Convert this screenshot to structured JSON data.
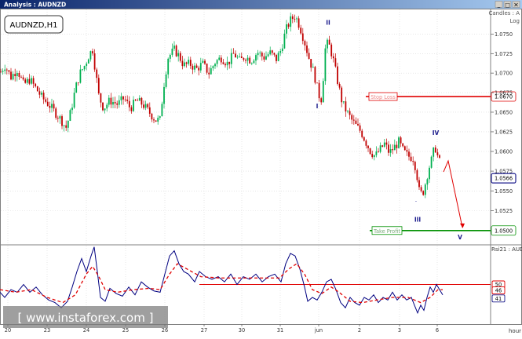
{
  "window": {
    "title": "Analysis : AUDNZD",
    "minimize_glyph": "_",
    "maximize_glyph": "□",
    "close_glyph": "×",
    "titlebar_color": "#0a246a",
    "titlebar_color_end": "#a6caf0"
  },
  "price_panel": {
    "symbol_label": "AUDNZD,H1",
    "chart_type_label": "Candles : A",
    "scale_label": "Log"
  },
  "indicator_panel": {
    "label": "Rsi21 : AUD",
    "levels_shown": [
      50,
      46,
      41
    ]
  },
  "watermark": "[ www.instaforex.com ]",
  "x_axis_unit": "hour",
  "colors": {
    "bull_candle": "#00b050",
    "bear_candle": "#c00000",
    "stop_loss": "#e00000",
    "take_profit": "#009000",
    "current_price": "#1a1a8c",
    "rsi": "#000080",
    "rsi_ma": "#e00000",
    "wave_label": "#1a1a8c",
    "grid": "#d8d8d8",
    "axis_text": "#333333"
  },
  "chart_data": [
    {
      "type": "candlestick",
      "title": "AUDNZD,H1",
      "x_ticks": [
        "20",
        "23",
        "24",
        "25",
        "26",
        "27",
        "30",
        "31",
        "jun",
        "2",
        "3",
        "6"
      ],
      "x_unit": "hour",
      "y_ticks": [
        "1.0750",
        "1.0725",
        "1.0700",
        "1.0675",
        "1.0650",
        "1.0625",
        "1.0600",
        "1.0575",
        "1.0550",
        "1.0525"
      ],
      "ylim": [
        1.0483,
        1.0782
      ],
      "log_scale": true,
      "grid": true,
      "price_path": [
        [
          0,
          1.07
        ],
        [
          6,
          1.071
        ],
        [
          14,
          1.0695
        ],
        [
          22,
          1.0705
        ],
        [
          30,
          1.0685
        ],
        [
          38,
          1.0692
        ],
        [
          46,
          1.068
        ],
        [
          54,
          1.0668
        ],
        [
          62,
          1.066
        ],
        [
          70,
          1.065
        ],
        [
          78,
          1.064
        ],
        [
          84,
          1.063
        ],
        [
          90,
          1.065
        ],
        [
          96,
          1.068
        ],
        [
          102,
          1.07
        ],
        [
          108,
          1.071
        ],
        [
          114,
          1.0725
        ],
        [
          118,
          1.073
        ],
        [
          122,
          1.07
        ],
        [
          126,
          1.067
        ],
        [
          132,
          1.0655
        ],
        [
          140,
          1.0665
        ],
        [
          150,
          1.066
        ],
        [
          158,
          1.0668
        ],
        [
          166,
          1.0655
        ],
        [
          174,
          1.0665
        ],
        [
          182,
          1.066
        ],
        [
          190,
          1.065
        ],
        [
          198,
          1.064
        ],
        [
          204,
          1.064
        ],
        [
          208,
          1.068
        ],
        [
          214,
          1.072
        ],
        [
          222,
          1.073
        ],
        [
          228,
          1.0722
        ],
        [
          234,
          1.071
        ],
        [
          242,
          1.0712
        ],
        [
          250,
          1.0705
        ],
        [
          258,
          1.0712
        ],
        [
          266,
          1.07
        ],
        [
          274,
          1.0714
        ],
        [
          282,
          1.072
        ],
        [
          290,
          1.0712
        ],
        [
          298,
          1.0725
        ],
        [
          306,
          1.0715
        ],
        [
          312,
          1.0722
        ],
        [
          320,
          1.0716
        ],
        [
          328,
          1.0727
        ],
        [
          336,
          1.072
        ],
        [
          344,
          1.0726
        ],
        [
          352,
          1.0718
        ],
        [
          358,
          1.073
        ],
        [
          364,
          1.0755
        ],
        [
          370,
          1.0768
        ],
        [
          376,
          1.0774
        ],
        [
          382,
          1.076
        ],
        [
          388,
          1.074
        ],
        [
          394,
          1.0718
        ],
        [
          400,
          1.07
        ],
        [
          406,
          1.0672
        ],
        [
          410,
          1.0666
        ],
        [
          414,
          1.073
        ],
        [
          418,
          1.074
        ],
        [
          424,
          1.072
        ],
        [
          430,
          1.069
        ],
        [
          436,
          1.0662
        ],
        [
          442,
          1.065
        ],
        [
          448,
          1.064
        ],
        [
          454,
          1.0632
        ],
        [
          460,
          1.0625
        ],
        [
          466,
          1.0612
        ],
        [
          472,
          1.06
        ],
        [
          478,
          1.0594
        ],
        [
          484,
          1.0602
        ],
        [
          490,
          1.061
        ],
        [
          496,
          1.0598
        ],
        [
          502,
          1.0605
        ],
        [
          508,
          1.0612
        ],
        [
          514,
          1.06
        ],
        [
          520,
          1.0594
        ],
        [
          526,
          1.0592
        ],
        [
          530,
          1.0578
        ],
        [
          534,
          1.055
        ],
        [
          538,
          1.0545
        ],
        [
          542,
          1.056
        ],
        [
          546,
          1.0578
        ],
        [
          550,
          1.059
        ],
        [
          554,
          1.0607
        ],
        [
          558,
          1.0592
        ],
        [
          562,
          1.0582
        ]
      ],
      "horizontal_levels": [
        {
          "name": "Stop Loss",
          "value": 1.067
        },
        {
          "name": "Take Profit",
          "value": 1.05
        }
      ],
      "current_price": 1.0566,
      "wave_labels": [
        {
          "text": "I",
          "x": 404,
          "price": 1.0655
        },
        {
          "text": "II",
          "x": 418,
          "price": 1.0762
        },
        {
          "text": "III",
          "x": 532,
          "price": 1.0511
        },
        {
          "text": "IV",
          "x": 555,
          "price": 1.0621
        },
        {
          "text": "V",
          "x": 586,
          "price": 1.0489
        }
      ],
      "wave_labels_small": [
        {
          "text": "-",
          "x": 530,
          "price": 1.0535
        }
      ],
      "projection": [
        [
          565,
          1.0574
        ],
        [
          571,
          1.0588
        ],
        [
          589,
          1.0504
        ]
      ]
    },
    {
      "type": "line",
      "title": "Rsi21 : AUD",
      "x_ticks": [
        "20",
        "23",
        "24",
        "25",
        "26",
        "27",
        "30",
        "31",
        "jun",
        "2",
        "3",
        "6"
      ],
      "x_unit": "hour",
      "levels": [
        50,
        46,
        41
      ],
      "ylim": [
        20,
        80
      ],
      "series": [
        {
          "values": [
            [
              0,
              44
            ],
            [
              6,
              40
            ],
            [
              14,
              46
            ],
            [
              22,
              44
            ],
            [
              30,
              50
            ],
            [
              38,
              44
            ],
            [
              46,
              48
            ],
            [
              54,
              42
            ],
            [
              62,
              38
            ],
            [
              70,
              36
            ],
            [
              78,
              32
            ],
            [
              86,
              37
            ],
            [
              92,
              48
            ],
            [
              98,
              60
            ],
            [
              104,
              70
            ],
            [
              110,
              60
            ],
            [
              116,
              72
            ],
            [
              120,
              79
            ],
            [
              124,
              60
            ],
            [
              128,
              40
            ],
            [
              134,
              37
            ],
            [
              140,
              47
            ],
            [
              148,
              43
            ],
            [
              156,
              41
            ],
            [
              164,
              48
            ],
            [
              172,
              42
            ],
            [
              180,
              52
            ],
            [
              188,
              48
            ],
            [
              196,
              45
            ],
            [
              204,
              44
            ],
            [
              210,
              58
            ],
            [
              216,
              72
            ],
            [
              222,
              76
            ],
            [
              228,
              66
            ],
            [
              234,
              60
            ],
            [
              240,
              58
            ],
            [
              248,
              52
            ],
            [
              254,
              60
            ],
            [
              262,
              56
            ],
            [
              270,
              54
            ],
            [
              278,
              56
            ],
            [
              286,
              52
            ],
            [
              294,
              58
            ],
            [
              302,
              50
            ],
            [
              310,
              56
            ],
            [
              318,
              54
            ],
            [
              326,
              58
            ],
            [
              334,
              52
            ],
            [
              342,
              56
            ],
            [
              350,
              58
            ],
            [
              358,
              52
            ],
            [
              364,
              66
            ],
            [
              370,
              74
            ],
            [
              376,
              72
            ],
            [
              382,
              62
            ],
            [
              388,
              48
            ],
            [
              392,
              37
            ],
            [
              398,
              40
            ],
            [
              404,
              38
            ],
            [
              410,
              44
            ],
            [
              416,
              52
            ],
            [
              422,
              54
            ],
            [
              428,
              46
            ],
            [
              434,
              36
            ],
            [
              440,
              32
            ],
            [
              446,
              40
            ],
            [
              452,
              36
            ],
            [
              458,
              34
            ],
            [
              464,
              40
            ],
            [
              470,
              38
            ],
            [
              476,
              42
            ],
            [
              482,
              36
            ],
            [
              488,
              40
            ],
            [
              494,
              38
            ],
            [
              500,
              44
            ],
            [
              506,
              38
            ],
            [
              512,
              42
            ],
            [
              518,
              38
            ],
            [
              524,
              40
            ],
            [
              528,
              34
            ],
            [
              532,
              28
            ],
            [
              536,
              34
            ],
            [
              540,
              30
            ],
            [
              544,
              40
            ],
            [
              548,
              48
            ],
            [
              552,
              44
            ],
            [
              556,
              50
            ],
            [
              560,
              46
            ],
            [
              564,
              42
            ]
          ]
        },
        {
          "values": [
            [
              0,
              46
            ],
            [
              20,
              44
            ],
            [
              40,
              46
            ],
            [
              60,
              40
            ],
            [
              80,
              36
            ],
            [
              96,
              42
            ],
            [
              110,
              58
            ],
            [
              118,
              64
            ],
            [
              126,
              56
            ],
            [
              134,
              46
            ],
            [
              150,
              44
            ],
            [
              170,
              46
            ],
            [
              190,
              47
            ],
            [
              204,
              46
            ],
            [
              216,
              58
            ],
            [
              226,
              66
            ],
            [
              238,
              62
            ],
            [
              256,
              56
            ],
            [
              280,
              55
            ],
            [
              304,
              55
            ],
            [
              330,
              55
            ],
            [
              356,
              55
            ],
            [
              368,
              62
            ],
            [
              378,
              66
            ],
            [
              388,
              58
            ],
            [
              398,
              46
            ],
            [
              410,
              43
            ],
            [
              422,
              48
            ],
            [
              432,
              44
            ],
            [
              446,
              37
            ],
            [
              462,
              36
            ],
            [
              480,
              38
            ],
            [
              500,
              40
            ],
            [
              520,
              40
            ],
            [
              536,
              36
            ],
            [
              548,
              40
            ],
            [
              558,
              46
            ],
            [
              564,
              46
            ]
          ]
        }
      ]
    }
  ]
}
